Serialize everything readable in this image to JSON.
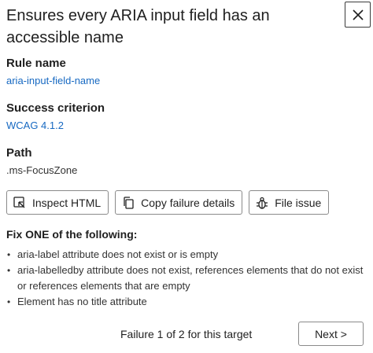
{
  "header": {
    "title": "Ensures every ARIA input field has an accessible name",
    "close_icon": "close-icon"
  },
  "details": {
    "rule_name_label": "Rule name",
    "rule_name_value": "aria-input-field-name",
    "success_criterion_label": "Success criterion",
    "success_criterion_value": "WCAG 4.1.2",
    "path_label": "Path",
    "path_value": ".ms-FocusZone"
  },
  "actions": [
    {
      "label": "Inspect HTML",
      "icon": "inspect-icon"
    },
    {
      "label": "Copy failure details",
      "icon": "copy-icon"
    },
    {
      "label": "File issue",
      "icon": "bug-icon"
    }
  ],
  "fix": {
    "title": "Fix ONE of the following:",
    "items": [
      "aria-label attribute does not exist or is empty",
      "aria-labelledby attribute does not exist, references elements that do not exist or references elements that are empty",
      "Element has no title attribute"
    ]
  },
  "footer": {
    "status": "Failure 1 of 2 for this target",
    "next_label": "Next >"
  },
  "colors": {
    "link": "#1769c2",
    "text": "#1f1f1f",
    "border": "#8a8a8a"
  }
}
